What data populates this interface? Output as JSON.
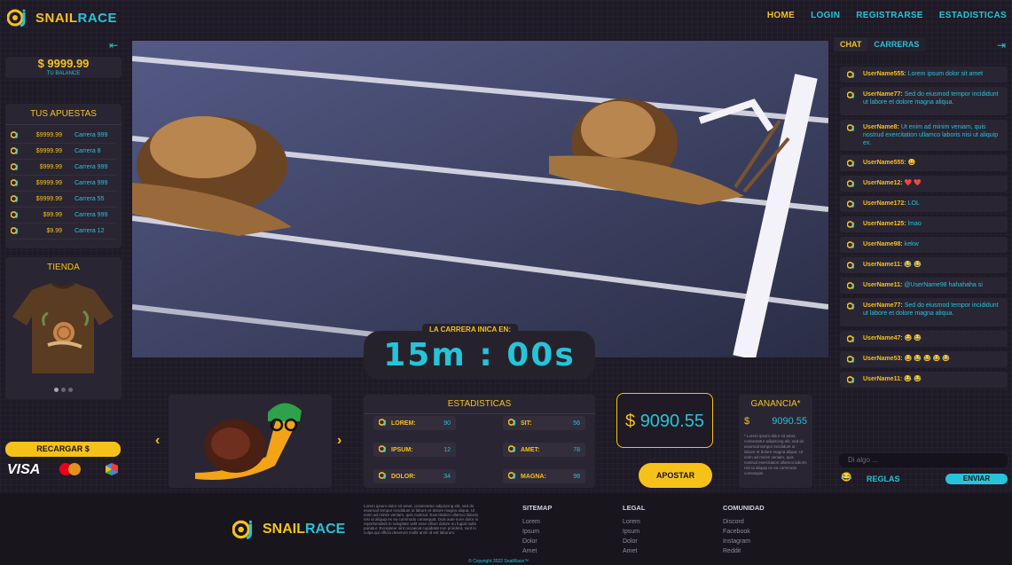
{
  "header": {
    "logo_a": "SNAIL",
    "logo_b": "RACE",
    "nav": [
      "HOME",
      "LOGIN",
      "REGISTRARSE",
      "ESTADISTICAS"
    ]
  },
  "balance": {
    "amount": "$ 9999.99",
    "label": "TU BALANCE"
  },
  "bets": {
    "title": "TUS APUESTAS",
    "items": [
      {
        "amount": "$9999.99",
        "race": "Carrera 999"
      },
      {
        "amount": "$9999.99",
        "race": "Carrera 8"
      },
      {
        "amount": "$999.99",
        "race": "Carrera 999"
      },
      {
        "amount": "$9999.99",
        "race": "Carrera 999"
      },
      {
        "amount": "$9999.99",
        "race": "Carrera 55"
      },
      {
        "amount": "$99.99",
        "race": "Carrera 999"
      },
      {
        "amount": "$9.99",
        "race": "Carrera 12"
      }
    ]
  },
  "shop": {
    "title": "TIENDA",
    "slides": 3,
    "active_slide": 0
  },
  "recharge_label": "RECARGAR $",
  "countdown": {
    "label": "LA CARRERA INICA EN:",
    "time": "15m : 00s"
  },
  "stats": {
    "title": "ESTADISTICAS",
    "items": [
      {
        "k": "LOREM:",
        "v": "90"
      },
      {
        "k": "SIT:",
        "v": "56"
      },
      {
        "k": "IPSUM:",
        "v": "12"
      },
      {
        "k": "AMET:",
        "v": "78"
      },
      {
        "k": "DOLOR:",
        "v": "34"
      },
      {
        "k": "MAGNA:",
        "v": "98"
      }
    ]
  },
  "bet": {
    "currency": "$",
    "amount": "9090.55",
    "button": "APOSTAR"
  },
  "gain": {
    "title": "GANANCIA*",
    "currency": "$",
    "amount": "9090.55",
    "disclaimer": "* Lorem ipsum dolor sit amet, consectetur adipiscing elit, sed do eiusmod tempor incididunt ut labore et dolore magna aliqua. Ut enim ad minim veniam, quis nostrud exercitation ullamco laboris nisi ut aliquip ex ea commodo consequat."
  },
  "chat": {
    "tabs": [
      "CHAT",
      "CARRERAS"
    ],
    "messages": [
      {
        "u": "UserName555:",
        "t": "Lorem ipsum dolor sit amet"
      },
      {
        "u": "UserName77:",
        "t": "Sed do eiusmod tempor incididunt ut labore et dolore magna aliqua."
      },
      {
        "u": "UserName8:",
        "t": "Ut enim ad minim veniam, quis nostrud exercitation ullamco laboris nisi ut aliquip ex."
      },
      {
        "u": "UserName555:",
        "t": "😀"
      },
      {
        "u": "UserName12:",
        "t": "❤️ ❤️"
      },
      {
        "u": "UserName172:",
        "t": "LOL"
      },
      {
        "u": "UserName125:",
        "t": "lmao"
      },
      {
        "u": "UserName98:",
        "t": "kekw"
      },
      {
        "u": "UserName11:",
        "t": "😂 😂"
      },
      {
        "u": "UserName11:",
        "t": "@UserName98 hahahaha si"
      },
      {
        "u": "UserName77:",
        "t": "Sed do eiusmod tempor incididunt ut labore et dolore magna aliqua."
      },
      {
        "u": "UserName47:",
        "t": "😂 😂"
      },
      {
        "u": "UserName53:",
        "t": "😂 😂 😂 😂 😂"
      },
      {
        "u": "UserName11:",
        "t": "😂 😂"
      }
    ],
    "input_placeholder": "Di algo ...",
    "rules": "REGLAS",
    "send": "ENVIAR"
  },
  "footer": {
    "about": "Lorem ipsum dolor sit amet, consectetur adipiscing elit, sed do eiusmod tempor incididunt ut labore et dolore magna aliqua. Ut enim ad minim veniam, quis nostrud. Exercitation ullamco laboris nisi ut aliquip ex ea commodo consequat. Duis aute irure dolor in reprehenderit in voluptate velit esse cillum dolore eu fugiat nulla pariatur. Excepteur sint occaecat cupidatat non proident, sunt in culpa qui officia deserunt mollit anim id est laborum.",
    "sitemap": {
      "title": "SITEMAP",
      "links": [
        "Lorem",
        "Ipsum",
        "Dolor",
        "Amet"
      ]
    },
    "legal": {
      "title": "LEGAL",
      "links": [
        "Lorem",
        "Ipsum",
        "Dolor",
        "Amet"
      ]
    },
    "community": {
      "title": "COMUNIDAD",
      "links": [
        "Discord",
        "Facebook",
        "Instagram",
        "Reddit"
      ]
    },
    "copyright": "© Copyright 2022 SnailRace™"
  },
  "colors": {
    "accent": "#f6c21a",
    "secondary": "#27c3d9",
    "bg": "#1e1a26"
  }
}
